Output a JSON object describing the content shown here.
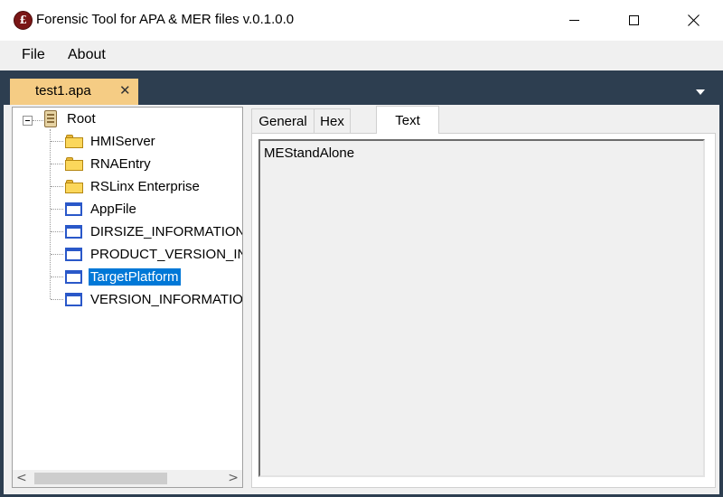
{
  "window": {
    "title": "Forensic Tool for APA & MER files v.0.1.0.0",
    "icon": "app-seal-icon",
    "icon_glyph": "£"
  },
  "menu": {
    "items": [
      {
        "label": "File"
      },
      {
        "label": "About"
      }
    ]
  },
  "document_tab": {
    "label": "test1.apa",
    "close_glyph": "✕",
    "color": "#f5cc84"
  },
  "tree": {
    "root": {
      "label": "Root",
      "icon": "root-node-icon"
    },
    "items": [
      {
        "label": "HMIServer",
        "icon": "folder-icon"
      },
      {
        "label": "RNAEntry",
        "icon": "folder-icon"
      },
      {
        "label": "RSLinx Enterprise",
        "icon": "folder-icon"
      },
      {
        "label": "AppFile",
        "icon": "file-icon"
      },
      {
        "label": "DIRSIZE_INFORMATION",
        "icon": "file-icon"
      },
      {
        "label": "PRODUCT_VERSION_INFO",
        "icon": "file-icon"
      },
      {
        "label": "TargetPlatform",
        "icon": "file-icon",
        "selected": true
      },
      {
        "label": "VERSION_INFORMATION",
        "icon": "file-icon"
      }
    ]
  },
  "scrollbar": {
    "left_glyph": "<",
    "right_glyph": ">"
  },
  "detail_tabs": {
    "items": [
      {
        "label": "General"
      },
      {
        "label": "Hex"
      },
      {
        "label": "Text",
        "active": true
      }
    ]
  },
  "text_view": {
    "content": "MEStandAlone"
  },
  "colors": {
    "workspace": "#2d3e50",
    "selection": "#0078d7"
  }
}
